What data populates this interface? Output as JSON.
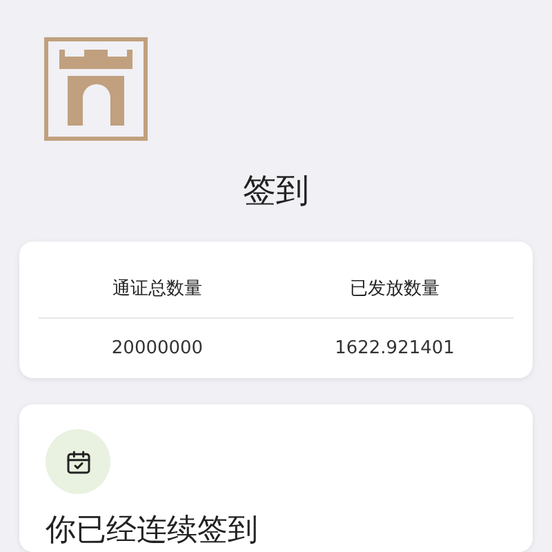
{
  "page": {
    "title": "签到"
  },
  "token_table": {
    "columns": [
      "通证总数量",
      "已发放数量"
    ],
    "values": [
      "20000000",
      "1622.921401"
    ]
  },
  "checkin_card": {
    "heading": "你已经连续签到"
  }
}
